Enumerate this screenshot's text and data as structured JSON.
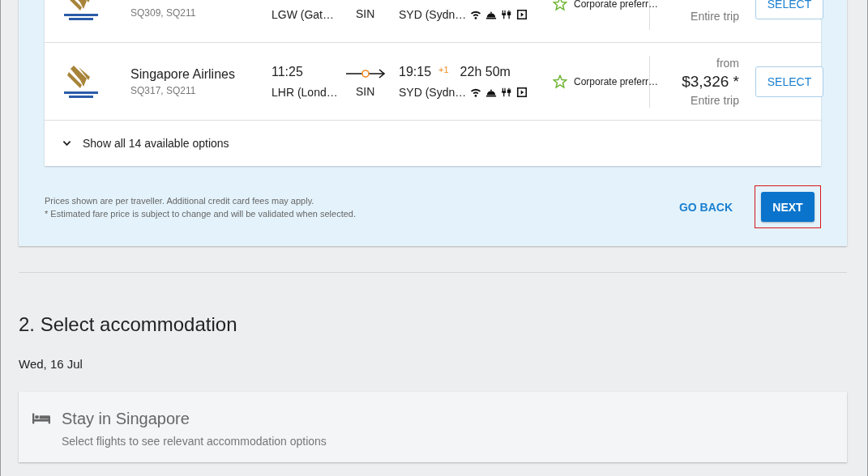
{
  "flights": [
    {
      "flight_numbers": "SQ309, SQ211",
      "depart_airport": "LGW (Gat…",
      "stop": "SIN",
      "arrive_airport": "SYD (Sydn…",
      "policy": "Corporate preferr…",
      "price_note": "Entire trip",
      "button": "SELECT"
    },
    {
      "airline": "Singapore Airlines",
      "flight_numbers": "SQ317, SQ211",
      "depart_time": "11:25",
      "depart_airport": "LHR (Lond…",
      "stop": "SIN",
      "arrive_time": "19:15",
      "day_offset": "+1",
      "arrive_airport": "SYD (Sydn…",
      "duration": "22h 50m",
      "policy": "Corporate preferr…",
      "price_prefix": "from",
      "price": "$3,326 *",
      "price_note": "Entire trip",
      "button": "SELECT"
    }
  ],
  "show_all": "Show all 14 available options",
  "notes": [
    "Prices shown are per traveller. Additional credit card fees may apply.",
    "* Estimated fare price is subject to change and will be validated when selected."
  ],
  "go_back": "GO BACK",
  "next": {
    "label": "NEXT",
    "highlighted": true
  },
  "section": {
    "title": "2. Select accommodation",
    "date": "Wed, 16 Jul",
    "card": {
      "title": "Stay in Singapore",
      "subtitle": "Select flights to see relevant accommodation options"
    }
  }
}
